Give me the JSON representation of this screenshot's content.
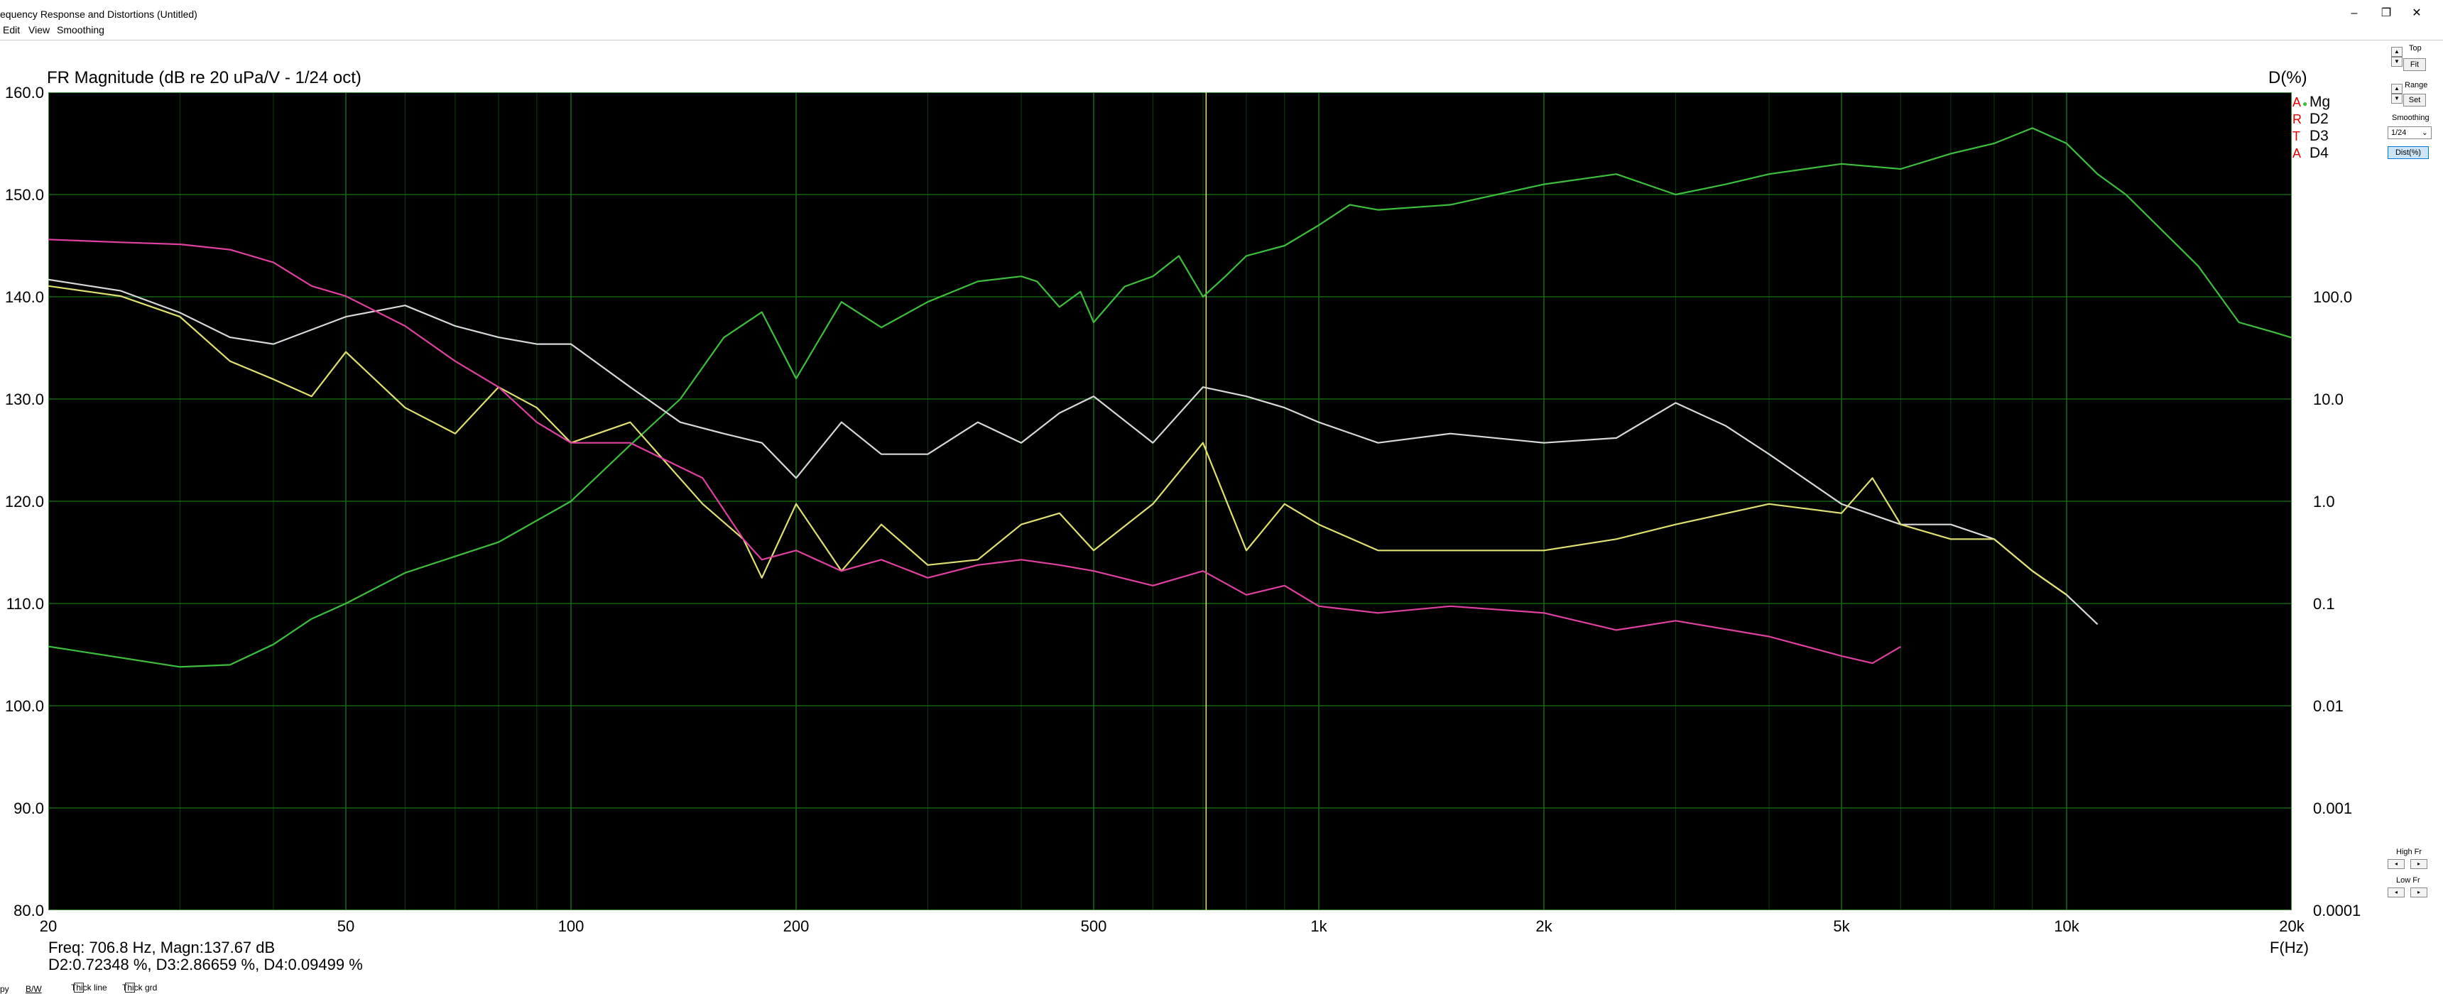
{
  "window": {
    "title": "equency Response and Distortions (Untitled)",
    "minimize": "–",
    "restore": "❐",
    "close": "✕"
  },
  "menu": [
    "Edit",
    "View",
    "Smoothing"
  ],
  "plot": {
    "title": "FR Magnitude (dB re 20 uPa/V - 1/24 oct)",
    "right_axis_title": "D(%)",
    "x_unit": "F(Hz)"
  },
  "readout": {
    "line1": "Freq: 706.8 Hz, Magn:137.67 dB",
    "line2": "D2:0.72348 %, D3:2.86659 %, D4:0.09499 %"
  },
  "legend": [
    {
      "art": "A",
      "name": "Mg",
      "color": "#3cc03c"
    },
    {
      "art": "R",
      "name": "D2",
      "color": "#d8d8d8"
    },
    {
      "art": "T",
      "name": "D3",
      "color": "#e0e070"
    },
    {
      "art": "A",
      "name": "D4",
      "color": "#e040a0"
    }
  ],
  "side": {
    "top_label": "Top",
    "fit_button": "Fit",
    "range_label": "Range",
    "set_button": "Set",
    "smoothing_label": "Smoothing",
    "smoothing_value": "1/24",
    "dist_button": "Dist(%)",
    "high_fr_label": "High Fr",
    "low_fr_label": "Low Fr"
  },
  "bottom": {
    "copy_label": "py",
    "bw_label": "B/W",
    "thick_line_label": "Thick line",
    "thick_grid_label": "Thick grd"
  },
  "chart_data": {
    "type": "line",
    "x_scale": "log",
    "xlim": [
      20,
      20000
    ],
    "x_ticks": [
      "20",
      "50",
      "100",
      "200",
      "500",
      "1k",
      "2k",
      "5k",
      "10k",
      "20k"
    ],
    "y_left": {
      "ylim": [
        80,
        160
      ],
      "ticks": [
        "160.0",
        "150.0",
        "140.0",
        "130.0",
        "120.0",
        "110.0",
        "100.0",
        "90.0",
        "80.0"
      ],
      "unit": "dB"
    },
    "y_right": {
      "scale": "log",
      "ylim": [
        0.0001,
        1000
      ],
      "ticks": [
        "100.0",
        "10.0",
        "1.0",
        "0.1",
        "0.01",
        "0.001",
        "0.0001"
      ],
      "unit": "%"
    },
    "cursor_freq": 706.8,
    "grid": true,
    "background": "#000000",
    "grid_color": "#1a6e1a",
    "series": [
      {
        "name": "Mg",
        "axis": "left",
        "color": "#3cc03c",
        "x": [
          20,
          30,
          35,
          40,
          45,
          50,
          60,
          80,
          100,
          120,
          140,
          160,
          180,
          200,
          230,
          260,
          300,
          350,
          400,
          420,
          450,
          480,
          500,
          550,
          600,
          650,
          700,
          750,
          800,
          900,
          1000,
          1100,
          1200,
          1500,
          2000,
          2500,
          3000,
          3500,
          4000,
          5000,
          6000,
          7000,
          8000,
          9000,
          10000,
          11000,
          12000,
          15000,
          17000,
          19000,
          20000
        ],
        "y": [
          105.8,
          103.8,
          104,
          106,
          108.5,
          110,
          113,
          116,
          120,
          125.5,
          130,
          136,
          138.5,
          132,
          139.5,
          137,
          139.5,
          141.5,
          142,
          141.5,
          139,
          140.5,
          137.5,
          141,
          142,
          144,
          140,
          142,
          144,
          145,
          147,
          149,
          148.5,
          149,
          151,
          152,
          150,
          151,
          152,
          153,
          152.5,
          154,
          155,
          156.5,
          155,
          152,
          150,
          143,
          137.5,
          136.5,
          136
        ]
      },
      {
        "name": "D2",
        "axis": "right",
        "color": "#d8d8d8",
        "x": [
          20,
          25,
          30,
          35,
          40,
          50,
          60,
          70,
          80,
          90,
          100,
          120,
          140,
          160,
          180,
          200,
          230,
          260,
          300,
          350,
          400,
          450,
          500,
          600,
          700,
          800,
          900,
          1000,
          1200,
          1500,
          2000,
          2500,
          3000,
          3500,
          4000,
          5000,
          6000,
          7000,
          8000,
          9000,
          10000,
          11000
        ],
        "y": [
          25,
          20,
          13,
          8,
          7,
          12,
          15,
          10,
          8,
          7,
          7,
          3,
          1.5,
          1.2,
          1.0,
          0.5,
          1.5,
          0.8,
          0.8,
          1.5,
          1.0,
          1.8,
          2.5,
          1.0,
          3.0,
          2.5,
          2.0,
          1.5,
          1.0,
          1.2,
          1.0,
          1.1,
          2.2,
          1.4,
          0.8,
          0.3,
          0.2,
          0.2,
          0.15,
          0.08,
          0.05,
          0.028
        ]
      },
      {
        "name": "D3",
        "axis": "right",
        "color": "#e0e070",
        "x": [
          20,
          25,
          30,
          35,
          40,
          45,
          50,
          60,
          70,
          80,
          90,
          100,
          120,
          150,
          170,
          180,
          200,
          230,
          260,
          300,
          350,
          400,
          450,
          500,
          600,
          700,
          800,
          900,
          1000,
          1200,
          1500,
          2000,
          2500,
          3000,
          4000,
          5000,
          5500,
          6000,
          7000,
          8000,
          9000,
          10000
        ],
        "y": [
          22,
          18,
          12,
          5,
          3.5,
          2.5,
          6,
          2,
          1.2,
          3,
          2,
          1.0,
          1.5,
          0.3,
          0.15,
          0.07,
          0.3,
          0.08,
          0.2,
          0.09,
          0.1,
          0.2,
          0.25,
          0.12,
          0.3,
          1.0,
          0.12,
          0.3,
          0.2,
          0.12,
          0.12,
          0.12,
          0.15,
          0.2,
          0.3,
          0.25,
          0.5,
          0.2,
          0.15,
          0.15,
          0.08,
          0.05
        ]
      },
      {
        "name": "D4",
        "axis": "right",
        "color": "#e040a0",
        "x": [
          20,
          25,
          30,
          35,
          40,
          45,
          50,
          60,
          70,
          80,
          90,
          100,
          120,
          150,
          170,
          180,
          200,
          230,
          260,
          300,
          350,
          400,
          450,
          500,
          600,
          700,
          800,
          900,
          1000,
          1200,
          1500,
          2000,
          2500,
          3000,
          4000,
          5000,
          5500,
          6000
        ],
        "y": [
          55,
          52,
          50,
          45,
          35,
          22,
          18,
          10,
          5,
          3,
          1.5,
          1.0,
          1.0,
          0.5,
          0.15,
          0.1,
          0.12,
          0.08,
          0.1,
          0.07,
          0.09,
          0.1,
          0.09,
          0.08,
          0.06,
          0.08,
          0.05,
          0.06,
          0.04,
          0.035,
          0.04,
          0.035,
          0.025,
          0.03,
          0.022,
          0.015,
          0.013,
          0.018
        ]
      }
    ]
  }
}
